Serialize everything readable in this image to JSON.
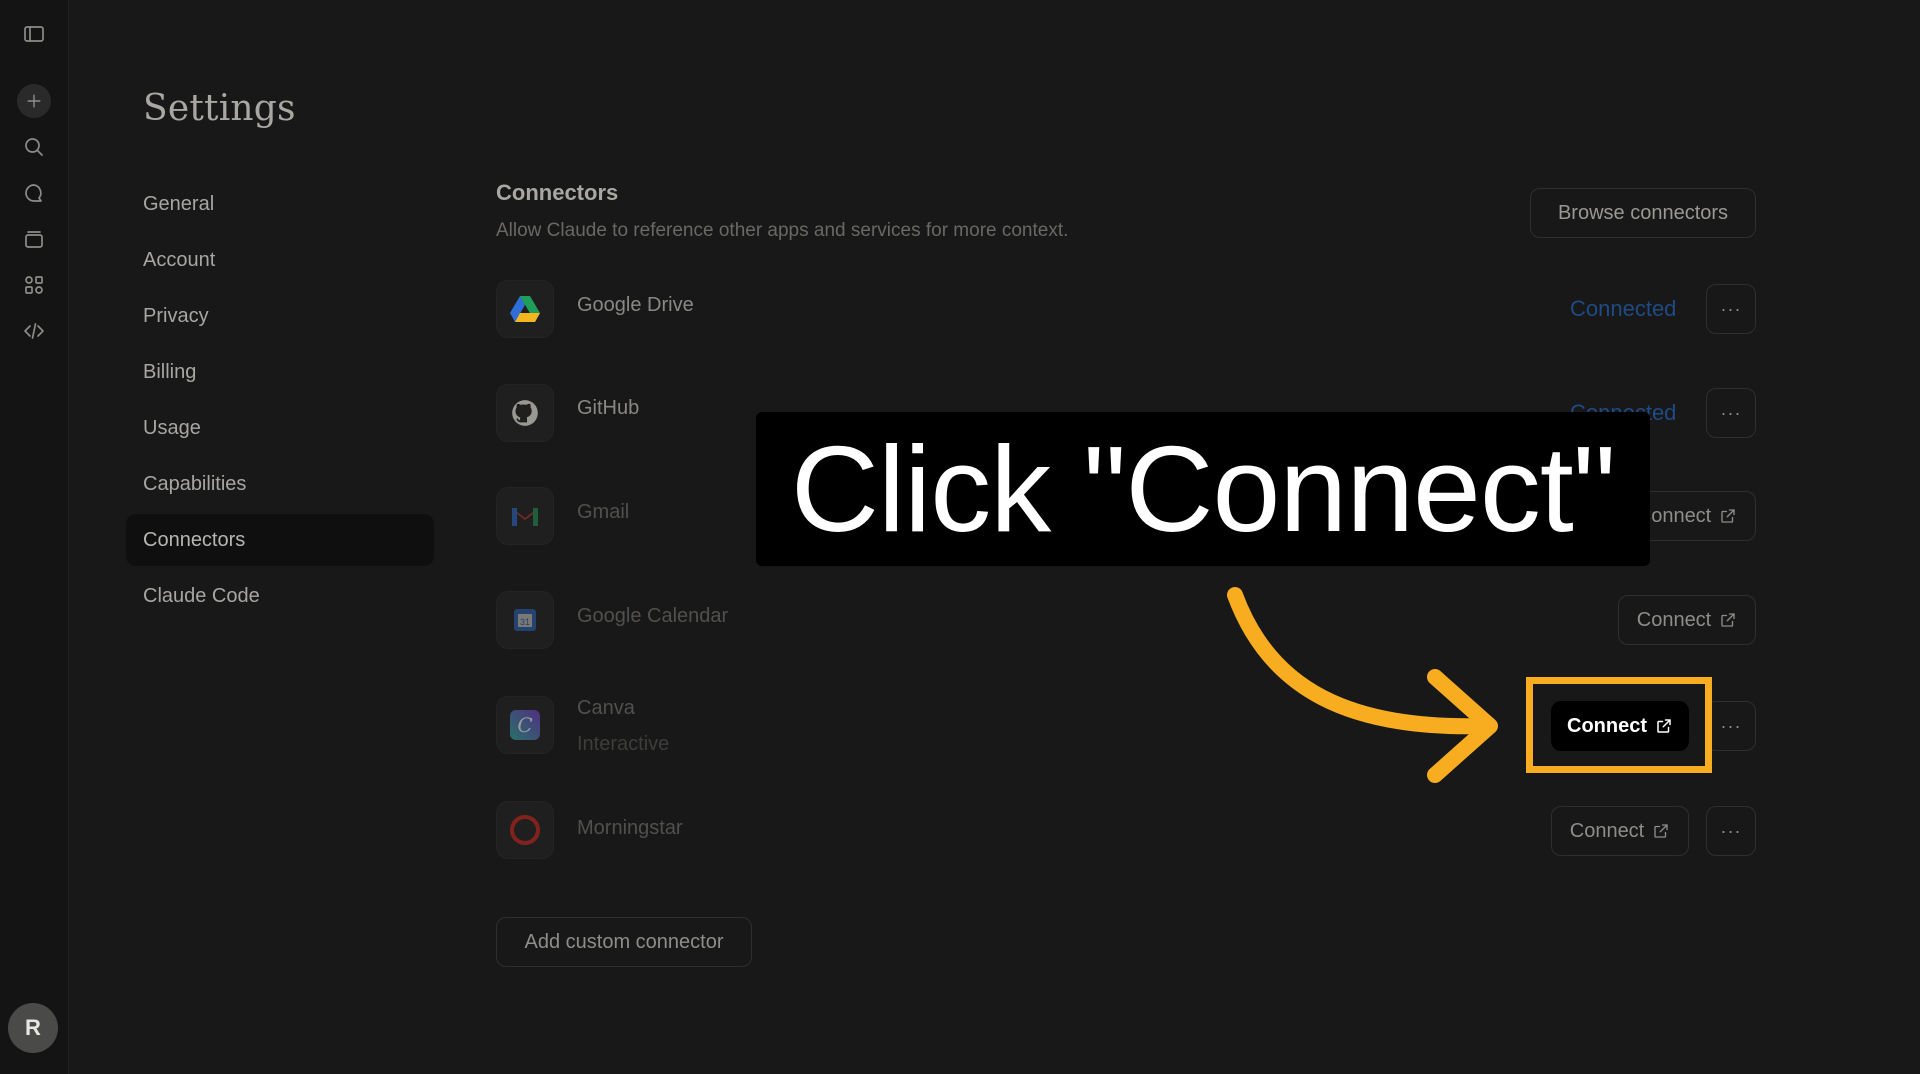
{
  "sidebar_rail": {
    "icons": [
      "sidebar-toggle-icon",
      "plus-icon",
      "search-icon",
      "chat-icon",
      "projects-icon",
      "artifacts-icon",
      "code-icon"
    ],
    "avatar_initial": "R"
  },
  "settings": {
    "title": "Settings",
    "nav": [
      {
        "label": "General"
      },
      {
        "label": "Account"
      },
      {
        "label": "Privacy"
      },
      {
        "label": "Billing"
      },
      {
        "label": "Usage"
      },
      {
        "label": "Capabilities"
      },
      {
        "label": "Connectors",
        "active": true
      },
      {
        "label": "Claude Code"
      }
    ]
  },
  "connectors": {
    "title": "Connectors",
    "subtitle": "Allow Claude to reference other apps and services for more context.",
    "browse_label": "Browse connectors",
    "add_custom_label": "Add custom connector",
    "more_label": "···",
    "items": [
      {
        "name": "Google Drive",
        "status": "Connected",
        "icon": "google-drive-icon"
      },
      {
        "name": "GitHub",
        "status": "Connected",
        "icon": "github-icon"
      },
      {
        "name": "Gmail",
        "action": "Connect",
        "icon": "gmail-icon"
      },
      {
        "name": "Google Calendar",
        "action": "Connect",
        "icon": "google-calendar-icon"
      },
      {
        "name": "Canva",
        "subtitle": "Interactive",
        "action": "Connect",
        "icon": "canva-icon"
      },
      {
        "name": "Morningstar",
        "action": "Connect",
        "icon": "morningstar-icon"
      }
    ]
  },
  "overlay": {
    "callout_text": "Click \"Connect\"",
    "highlight_color": "#f7ad1f"
  },
  "colors": {
    "background": "#181818",
    "connected_text": "#1e4a85",
    "accent_arrow": "#f7ad1f"
  }
}
